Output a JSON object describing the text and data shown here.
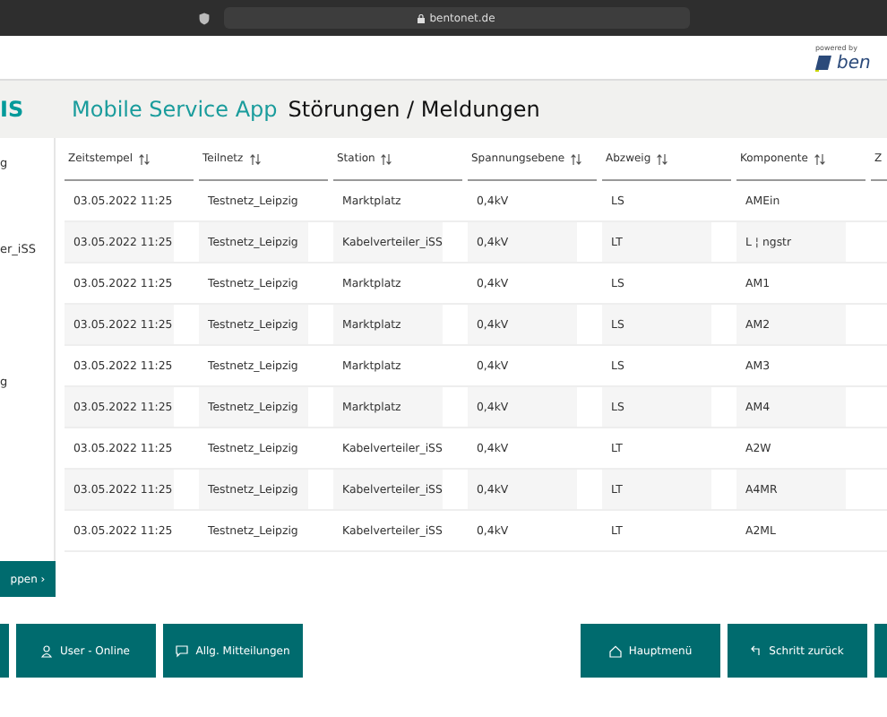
{
  "browser": {
    "url": "bentonet.de"
  },
  "header": {
    "powered_by": "powered by",
    "logo_text": "ben"
  },
  "title_bar": {
    "brand": "IS",
    "app_name": "Mobile Service App",
    "page_title": "Störungen / Meldungen"
  },
  "sidebar": {
    "items": [
      "g",
      "er_iSS",
      "g"
    ],
    "button": "ppen ›"
  },
  "table": {
    "columns": [
      "Zeitstempel",
      "Teilnetz",
      "Station",
      "Spannungsebene",
      "Abzweig",
      "Komponente",
      "Z"
    ],
    "rows": [
      [
        "03.05.2022 11:25",
        "Testnetz_Leipzig",
        "Marktplatz",
        "0,4kV",
        "LS",
        "AMEin"
      ],
      [
        "03.05.2022 11:25",
        "Testnetz_Leipzig",
        "Kabelverteiler_iSS",
        "0,4kV",
        "LT",
        "L ¦ ngstr"
      ],
      [
        "03.05.2022 11:25",
        "Testnetz_Leipzig",
        "Marktplatz",
        "0,4kV",
        "LS",
        "AM1"
      ],
      [
        "03.05.2022 11:25",
        "Testnetz_Leipzig",
        "Marktplatz",
        "0,4kV",
        "LS",
        "AM2"
      ],
      [
        "03.05.2022 11:25",
        "Testnetz_Leipzig",
        "Marktplatz",
        "0,4kV",
        "LS",
        "AM3"
      ],
      [
        "03.05.2022 11:25",
        "Testnetz_Leipzig",
        "Marktplatz",
        "0,4kV",
        "LS",
        "AM4"
      ],
      [
        "03.05.2022 11:25",
        "Testnetz_Leipzig",
        "Kabelverteiler_iSS",
        "0,4kV",
        "LT",
        "A2W"
      ],
      [
        "03.05.2022 11:25",
        "Testnetz_Leipzig",
        "Kabelverteiler_iSS",
        "0,4kV",
        "LT",
        "A4MR"
      ],
      [
        "03.05.2022 11:25",
        "Testnetz_Leipzig",
        "Kabelverteiler_iSS",
        "0,4kV",
        "LT",
        "A2ML"
      ]
    ]
  },
  "footer": {
    "left_buttons": [
      {
        "kind": "cut"
      },
      {
        "kind": "user",
        "label": "User - Online"
      },
      {
        "kind": "message",
        "label": "Allg. Mitteilungen"
      }
    ],
    "right_buttons": [
      {
        "kind": "home",
        "label": "Hauptmenü"
      },
      {
        "kind": "back",
        "label": "Schritt zurück"
      },
      {
        "kind": "cut"
      }
    ]
  }
}
